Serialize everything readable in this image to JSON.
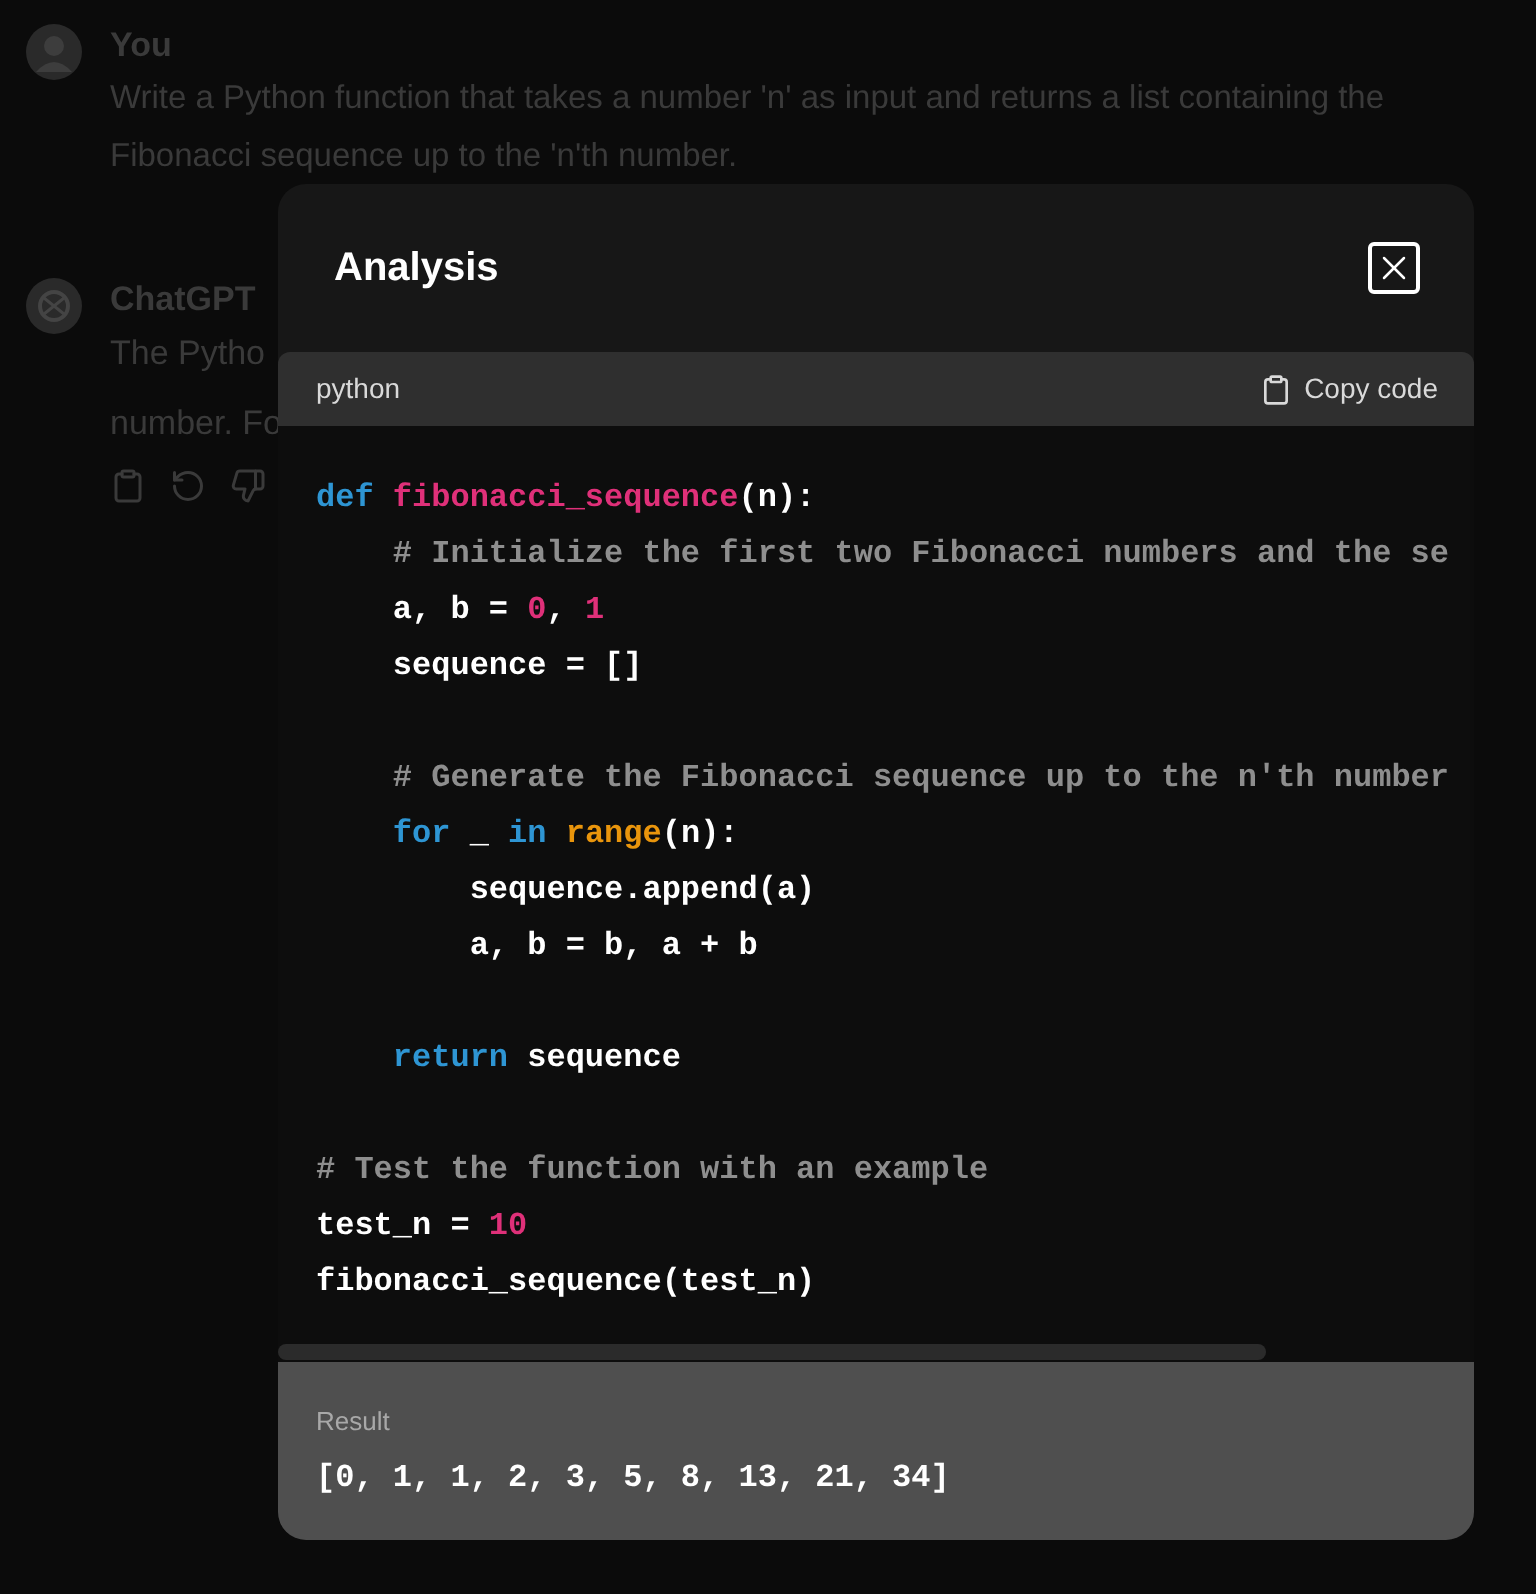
{
  "chat": [
    {
      "kind": "user",
      "author": "You",
      "text": "Write a Python function that takes a number 'n' as input and returns a list containing the Fibonacci sequence up to the 'n'th number."
    },
    {
      "kind": "assistant",
      "author": "ChatGPT",
      "lines": [
        "The Pytho",
        "number. Fo"
      ]
    }
  ],
  "modal": {
    "title": "Analysis",
    "code": {
      "language": "python",
      "copy_label": "Copy code",
      "lines": [
        {
          "kind": "code",
          "tokens": [
            {
              "kind": "keyword",
              "text": "def "
            },
            {
              "kind": "function",
              "text": "fibonacci_sequence"
            },
            {
              "kind": "plain",
              "text": "(n):"
            }
          ]
        },
        {
          "kind": "code",
          "tokens": [
            {
              "kind": "comment",
              "text": "    # Initialize the first two Fibonacci numbers and the se"
            }
          ]
        },
        {
          "kind": "code",
          "tokens": [
            {
              "kind": "plain",
              "text": "    a, b = "
            },
            {
              "kind": "number",
              "text": "0"
            },
            {
              "kind": "plain",
              "text": ", "
            },
            {
              "kind": "number",
              "text": "1"
            }
          ]
        },
        {
          "kind": "code",
          "tokens": [
            {
              "kind": "plain",
              "text": "    sequence = []"
            }
          ]
        },
        {
          "kind": "blank"
        },
        {
          "kind": "code",
          "tokens": [
            {
              "kind": "comment",
              "text": "    # Generate the Fibonacci sequence up to the n'th number"
            }
          ]
        },
        {
          "kind": "code",
          "tokens": [
            {
              "kind": "keyword",
              "text": "    for"
            },
            {
              "kind": "plain",
              "text": " _ "
            },
            {
              "kind": "keyword",
              "text": "in "
            },
            {
              "kind": "builtin",
              "text": "range"
            },
            {
              "kind": "plain",
              "text": "(n):"
            }
          ]
        },
        {
          "kind": "code",
          "tokens": [
            {
              "kind": "plain",
              "text": "        sequence.append(a)"
            }
          ]
        },
        {
          "kind": "code",
          "tokens": [
            {
              "kind": "plain",
              "text": "        a, b = b, a + b"
            }
          ]
        },
        {
          "kind": "blank"
        },
        {
          "kind": "code",
          "tokens": [
            {
              "kind": "keyword",
              "text": "    return"
            },
            {
              "kind": "plain",
              "text": " sequence"
            }
          ]
        },
        {
          "kind": "blank"
        },
        {
          "kind": "code",
          "tokens": [
            {
              "kind": "comment",
              "text": "# Test the function with an example"
            }
          ]
        },
        {
          "kind": "code",
          "tokens": [
            {
              "kind": "plain",
              "text": "test_n = "
            },
            {
              "kind": "number",
              "text": "10"
            }
          ]
        },
        {
          "kind": "code",
          "tokens": [
            {
              "kind": "plain",
              "text": "fibonacci_sequence(test_n)"
            }
          ]
        }
      ]
    },
    "result": {
      "label": "Result",
      "value": "[0, 1, 1, 2, 3, 5, 8, 13, 21, 34]"
    }
  }
}
